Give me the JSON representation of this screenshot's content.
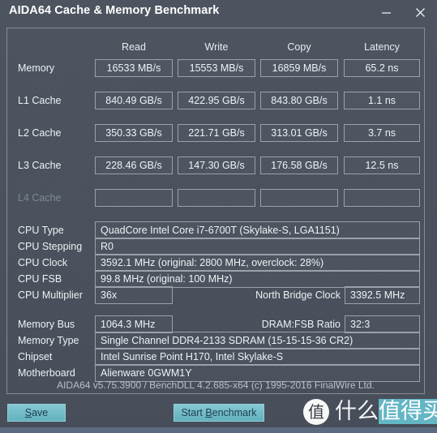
{
  "window": {
    "title": "AIDA64 Cache & Memory Benchmark",
    "minimize_icon": "minimize-icon",
    "close_icon": "close-icon"
  },
  "benchmark_table": {
    "columns": [
      "Read",
      "Write",
      "Copy",
      "Latency"
    ],
    "rows": [
      {
        "label": "Memory",
        "enabled": true,
        "read": "16533 MB/s",
        "write": "15553 MB/s",
        "copy": "16859 MB/s",
        "latency": "65.2 ns"
      },
      {
        "label": "L1 Cache",
        "enabled": true,
        "read": "840.49 GB/s",
        "write": "422.95 GB/s",
        "copy": "843.80 GB/s",
        "latency": "1.1 ns"
      },
      {
        "label": "L2 Cache",
        "enabled": true,
        "read": "350.33 GB/s",
        "write": "221.71 GB/s",
        "copy": "313.01 GB/s",
        "latency": "3.7 ns"
      },
      {
        "label": "L3 Cache",
        "enabled": true,
        "read": "228.46 GB/s",
        "write": "147.30 GB/s",
        "copy": "176.58 GB/s",
        "latency": "12.5 ns"
      },
      {
        "label": "L4 Cache",
        "enabled": false,
        "read": "",
        "write": "",
        "copy": "",
        "latency": ""
      }
    ]
  },
  "cpu_info": {
    "cpu_type_label": "CPU Type",
    "cpu_type_value": "QuadCore Intel Core i7-6700T  (Skylake-S, LGA1151)",
    "cpu_stepping_label": "CPU Stepping",
    "cpu_stepping_value": "R0",
    "cpu_clock_label": "CPU Clock",
    "cpu_clock_value": "3592.1 MHz  (original: 2800 MHz, overclock: 28%)",
    "cpu_fsb_label": "CPU FSB",
    "cpu_fsb_value": "99.8 MHz  (original: 100 MHz)",
    "cpu_multiplier_label": "CPU Multiplier",
    "cpu_multiplier_value": "36x",
    "north_bridge_clock_label": "North Bridge Clock",
    "north_bridge_clock_value": "3392.5 MHz"
  },
  "memory_info": {
    "memory_bus_label": "Memory Bus",
    "memory_bus_value": "1064.3 MHz",
    "dram_fsb_ratio_label": "DRAM:FSB Ratio",
    "dram_fsb_ratio_value": "32:3",
    "memory_type_label": "Memory Type",
    "memory_type_value": "Single Channel DDR4-2133 SDRAM  (15-15-15-36 CR2)",
    "chipset_label": "Chipset",
    "chipset_value": "Intel Sunrise Point H170, Intel Skylake-S",
    "motherboard_label": "Motherboard",
    "motherboard_value": "Alienware 0GWM1Y"
  },
  "footer": {
    "version_text": "AIDA64 v5.75.3900 / BenchDLL 4.2.685-x64  (c) 1995-2016 FinalWire Ltd."
  },
  "buttons": {
    "save_prefix": "",
    "save_accel": "S",
    "save_suffix": "ave",
    "start_prefix": "Start ",
    "start_accel": "B",
    "start_suffix": "enchmark"
  },
  "watermark": {
    "badge_char": "值",
    "text_plain": "什么",
    "text_highlight": "值得买"
  },
  "colors": {
    "window_bg": "#4a515c",
    "panel_border": "#868d96",
    "field_border": "#9aa1aa",
    "text": "#eef1f4",
    "text_dim": "#7e8994",
    "accent_teal": "#74bcc8",
    "bottom_strip": "#5b6b80"
  }
}
